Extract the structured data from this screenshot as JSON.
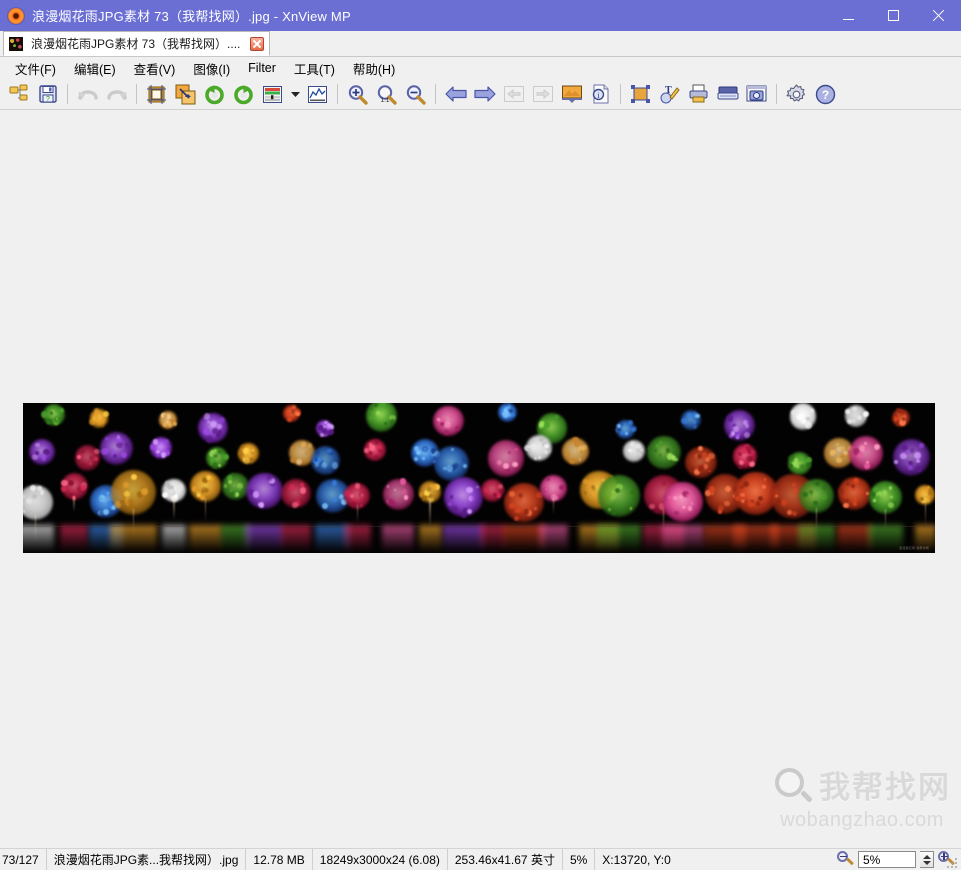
{
  "window": {
    "title": "浪漫烟花雨JPG素材 73（我帮找网）.jpg - XnView MP",
    "app_icon": "xnview-logo-icon",
    "minimize_label": "minimize",
    "maximize_label": "maximize",
    "close_label": "close"
  },
  "tabs": [
    {
      "label": "浪漫烟花雨JPG素材 73（我帮找网）....",
      "thumb": "image-thumbnail-icon",
      "close_label": "×"
    }
  ],
  "menu": {
    "items": [
      {
        "label": "文件(F)",
        "name": "menu-file"
      },
      {
        "label": "编辑(E)",
        "name": "menu-edit"
      },
      {
        "label": "查看(V)",
        "name": "menu-view"
      },
      {
        "label": "图像(I)",
        "name": "menu-image"
      },
      {
        "label": "Filter",
        "name": "menu-filter"
      },
      {
        "label": "工具(T)",
        "name": "menu-tools"
      },
      {
        "label": "帮助(H)",
        "name": "menu-help"
      }
    ]
  },
  "toolbar": {
    "buttons": [
      {
        "name": "browser-icon",
        "title": "浏览器",
        "disabled": false
      },
      {
        "name": "save-icon",
        "title": "保存",
        "disabled": false
      },
      {
        "name": "undo-icon",
        "title": "撤销",
        "disabled": true
      },
      {
        "name": "redo-icon",
        "title": "重做",
        "disabled": true
      },
      {
        "name": "crop-icon",
        "title": "裁剪",
        "disabled": false
      },
      {
        "name": "resize-icon",
        "title": "调整大小",
        "disabled": false
      },
      {
        "name": "rotate-left-icon",
        "title": "左旋转",
        "disabled": false
      },
      {
        "name": "rotate-right-icon",
        "title": "右旋转",
        "disabled": false
      },
      {
        "name": "adjust-colors-icon",
        "title": "调整颜色",
        "disabled": false
      },
      {
        "name": "chevron-down-icon",
        "title": "更多",
        "disabled": false
      },
      {
        "name": "histogram-icon",
        "title": "直方图",
        "disabled": false
      },
      {
        "name": "zoom-in-icon",
        "title": "放大",
        "disabled": false
      },
      {
        "name": "zoom-actual-icon",
        "title": "实际大小 1:1",
        "disabled": false
      },
      {
        "name": "zoom-out-icon",
        "title": "缩小",
        "disabled": false
      },
      {
        "name": "previous-image-icon",
        "title": "上一张",
        "disabled": false
      },
      {
        "name": "next-image-icon",
        "title": "下一张",
        "disabled": false
      },
      {
        "name": "first-image-icon",
        "title": "第一张",
        "disabled": true
      },
      {
        "name": "last-image-icon",
        "title": "最后一张",
        "disabled": true
      },
      {
        "name": "slideshow-icon",
        "title": "幻灯片",
        "disabled": false
      },
      {
        "name": "image-info-icon",
        "title": "图像信息",
        "disabled": false
      },
      {
        "name": "fullscreen-icon",
        "title": "全屏",
        "disabled": false
      },
      {
        "name": "text-draw-icon",
        "title": "绘制/文字",
        "disabled": false
      },
      {
        "name": "print-icon",
        "title": "打印",
        "disabled": false
      },
      {
        "name": "scanner-icon",
        "title": "扫描",
        "disabled": false
      },
      {
        "name": "screen-capture-icon",
        "title": "屏幕捕获",
        "disabled": false
      },
      {
        "name": "settings-gear-icon",
        "title": "设置",
        "disabled": false
      },
      {
        "name": "help-icon",
        "title": "帮助",
        "disabled": false
      }
    ]
  },
  "statusbar": {
    "index": "73/127",
    "filename": "浪漫烟花雨JPG素...我帮找网）.jpg",
    "filesize": "12.78 MB",
    "dimensions": "18249x3000x24 (6.08)",
    "print_size": "253.46x41.67 英寸",
    "zoom_percent": "5%",
    "cursor": "X:13720, Y:0",
    "zoom_field_value": "5%",
    "zoom_out_icon": "zoom-out-icon",
    "zoom_in_icon": "zoom-in-icon",
    "spinner_name": "zoom-stepper"
  },
  "watermark": {
    "chinese": "我帮找网",
    "english": "wobangzhao.com",
    "icon": "magnifier-icon"
  },
  "image": {
    "credit": "浪漫烟花雨 我帮找网",
    "alt": "panoramic-fireworks-photo",
    "background": "#000000"
  },
  "colors": {
    "titlebar": "#6b6fd4",
    "chrome": "#f0f0f0",
    "canvas": "#f0f0f0",
    "tab_active": "#ffffff",
    "watermark": "#d8d8d8"
  }
}
